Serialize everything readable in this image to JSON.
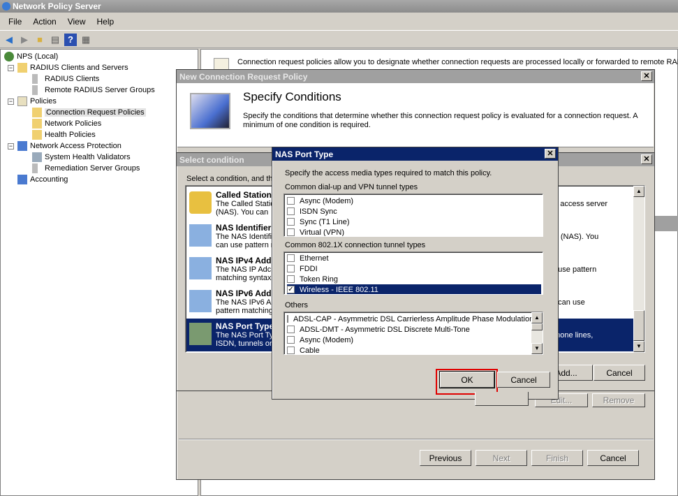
{
  "app": {
    "title": "Network Policy Server",
    "menu": [
      "File",
      "Action",
      "View",
      "Help"
    ],
    "toolbar": [
      "back-icon",
      "forward-icon",
      "up-folder-icon",
      "show-hide-tree-icon",
      "help-icon",
      "properties-icon"
    ]
  },
  "tree": {
    "items": [
      "NPS (Local)",
      "RADIUS Clients and Servers",
      "RADIUS Clients",
      "Remote RADIUS Server Groups",
      "Policies",
      "Connection Request Policies",
      "Network Policies",
      "Health Policies",
      "Network Access Protection",
      "System Health Validators",
      "Remediation Server Groups",
      "Accounting"
    ]
  },
  "right_pane": {
    "info": "Connection request policies allow you to designate whether connection requests are processed locally or forwarded to remote RADIUS"
  },
  "wizard": {
    "title": "New Connection Request Policy",
    "heading": "Specify Conditions",
    "description": "Specify the conditions that determine whether this connection request policy is evaluated for a connection request. A minimum of one condition is required.",
    "add": "Add...",
    "edit": "Edit...",
    "remove": "Remove",
    "previous": "Previous",
    "next": "Next",
    "finish": "Finish",
    "cancel": "Cancel"
  },
  "select_condition": {
    "title": "Select condition",
    "prompt": "Select a condition, and th",
    "items": [
      {
        "name": "Called Station I",
        "desc1": "The Called Statio",
        "desc2": "(NAS). You can",
        "desc_right": "rk access server"
      },
      {
        "name": "NAS Identifier",
        "desc1": "The NAS Identifi",
        "desc2": "can use pattern r",
        "desc_right": "er (NAS). You"
      },
      {
        "name": "NAS IPv4 Addr",
        "desc1": "The NAS IP Adc",
        "desc2": "matching syntax t",
        "desc_right": "n use pattern"
      },
      {
        "name": "NAS IPv6 Addr",
        "desc1": "The NAS IPv6 A",
        "desc2": "pattern matching",
        "desc_right": "n can use"
      },
      {
        "name": "NAS Port Type",
        "desc1": "The NAS Port Ty",
        "desc2": "ISDN, tunnels or",
        "desc_right": "phone lines,"
      }
    ],
    "selected_index": 4,
    "add": "Add...",
    "cancel": "Cancel"
  },
  "nas_port_type": {
    "title": "NAS Port Type",
    "instruction": "Specify the access media types required to match this policy.",
    "group1_label": "Common dial-up and VPN tunnel types",
    "group1": [
      {
        "label": "Async (Modem)",
        "checked": false
      },
      {
        "label": "ISDN Sync",
        "checked": false
      },
      {
        "label": "Sync (T1 Line)",
        "checked": false
      },
      {
        "label": "Virtual (VPN)",
        "checked": false
      }
    ],
    "group2_label": "Common 802.1X connection tunnel types",
    "group2": [
      {
        "label": "Ethernet",
        "checked": false
      },
      {
        "label": "FDDI",
        "checked": false
      },
      {
        "label": "Token Ring",
        "checked": false
      },
      {
        "label": "Wireless - IEEE 802.11",
        "checked": true
      }
    ],
    "group3_label": "Others",
    "group3": [
      {
        "label": "ADSL-CAP - Asymmetric DSL Carrierless Amplitude Phase Modulation",
        "checked": false
      },
      {
        "label": "ADSL-DMT - Asymmetric DSL Discrete Multi-Tone",
        "checked": false
      },
      {
        "label": "Async (Modem)",
        "checked": false
      },
      {
        "label": "Cable",
        "checked": false
      }
    ],
    "ok": "OK",
    "cancel": "Cancel",
    "highlight_color": "#e00000"
  }
}
